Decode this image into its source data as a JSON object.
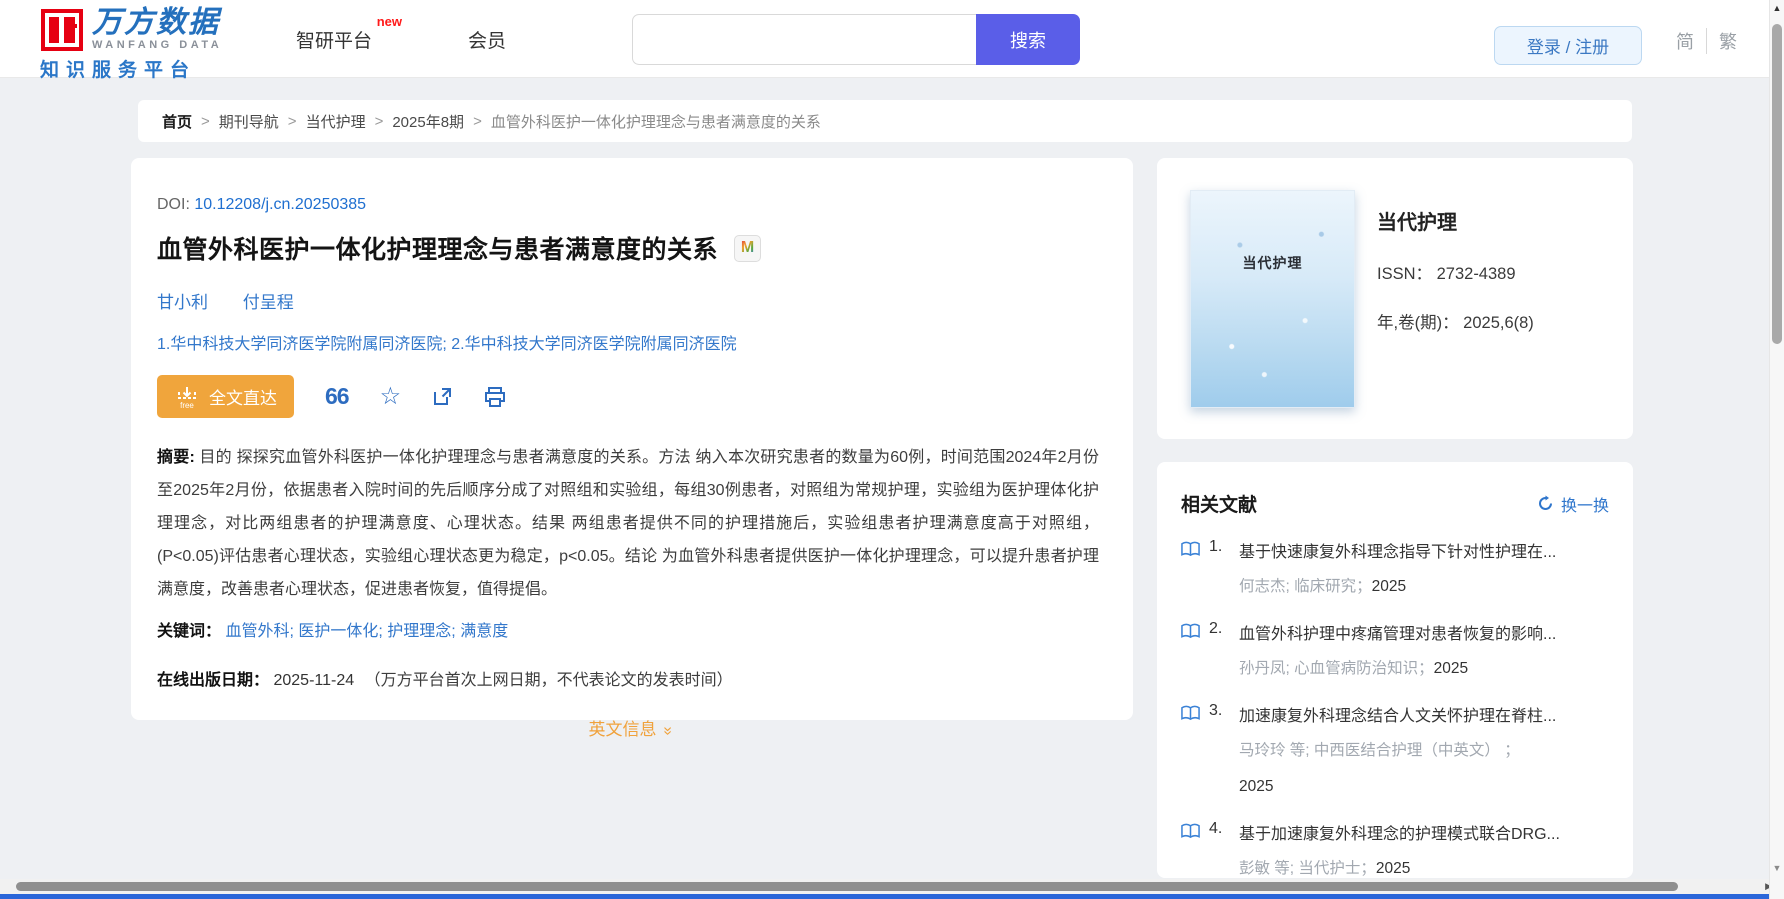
{
  "header": {
    "logo": {
      "brand_cn": "万方数据",
      "brand_en": "WANFANG DATA",
      "subtitle": "知识服务平台"
    },
    "nav": {
      "platform": "智研平台",
      "platform_badge": "new",
      "member": "会员"
    },
    "search": {
      "value": "",
      "placeholder": "",
      "button_label": "搜索"
    },
    "login_register": "登录 / 注册",
    "lang": {
      "simplified": "简",
      "traditional": "繁"
    }
  },
  "breadcrumb": {
    "separator": ">",
    "items": [
      "首页",
      "期刊导航",
      "当代护理",
      "2025年8期",
      "血管外科医护一体化护理理念与患者满意度的关系"
    ]
  },
  "article": {
    "doi_label": "DOI:",
    "doi": "10.12208/j.cn.20250385",
    "title": "血管外科医护一体化护理理念与患者满意度的关系",
    "badge": "M",
    "authors": [
      "甘小利",
      "付呈程"
    ],
    "affiliations": "1.华中科技大学同济医学院附属同济医院; 2.华中科技大学同济医学院附属同济医院",
    "fulltext_button": "全文直达",
    "fulltext_icon_text": "free",
    "abstract_label": "摘要:",
    "abstract": "目的 探探究血管外科医护一体化护理理念与患者满意度的关系。方法 纳入本次研究患者的数量为60例，时间范围2024年2月份至2025年2月份，依据患者入院时间的先后顺序分成了对照组和实验组，每组30例患者，对照组为常规护理，实验组为医护理体化护理理念，对比两组患者的护理满意度、心理状态。结果 两组患者提供不同的护理措施后，实验组患者护理满意度高于对照组， (P<0.05)评估患者心理状态，实验组心理状态更为稳定，p<0.05。结论 为血管外科患者提供医护一体化护理理念，可以提升患者护理满意度，改善患者心理状态，促进患者恢复，值得提倡。",
    "keywords_label": "关键词：",
    "keywords": [
      "血管外科",
      "医护一体化",
      "护理理念",
      "满意度"
    ],
    "keywords_sep": "; ",
    "online_date_label": "在线出版日期：",
    "online_date": "2025-11-24",
    "online_date_note": "（万方平台首次上网日期，不代表论文的发表时间）",
    "english_info": "英文信息"
  },
  "journal": {
    "cover_title": "当代护理",
    "name": "当代护理",
    "issn_label": "ISSN：",
    "issn": "2732-4389",
    "volume_label": "年,卷(期)：",
    "volume": "2025,6(8)"
  },
  "related": {
    "title": "相关文献",
    "refresh_label": "换一换",
    "items": [
      {
        "no": "1.",
        "title": "基于快速康复外科理念指导下针对性护理在...",
        "meta": "何志杰; 临床研究；",
        "year": "2025"
      },
      {
        "no": "2.",
        "title": "血管外科护理中疼痛管理对患者恢复的影响...",
        "meta": "孙丹凤; 心血管病防治知识；",
        "year": "2025"
      },
      {
        "no": "3.",
        "title": "加速康复外科理念结合人文关怀护理在脊柱...",
        "meta": "马玲玲 等;  中西医结合护理（中英文） ；",
        "year": "2025"
      },
      {
        "no": "4.",
        "title": "基于加速康复外科理念的护理模式联合DRG...",
        "meta": "彭敏 等;  当代护士；",
        "year": "2025"
      }
    ]
  },
  "icons": {
    "quote": "66",
    "star": "☆",
    "chevron_double_right": "»",
    "scroll_up": "▲",
    "scroll_down": "▼",
    "scroll_right": "▶"
  },
  "colors": {
    "brand_red": "#e60012",
    "brand_blue": "#2470bd",
    "link_blue": "#2f76cc",
    "search_indigo": "#5a5ee8",
    "button_orange": "#f0a53c",
    "english_orange": "#f0a23c"
  }
}
